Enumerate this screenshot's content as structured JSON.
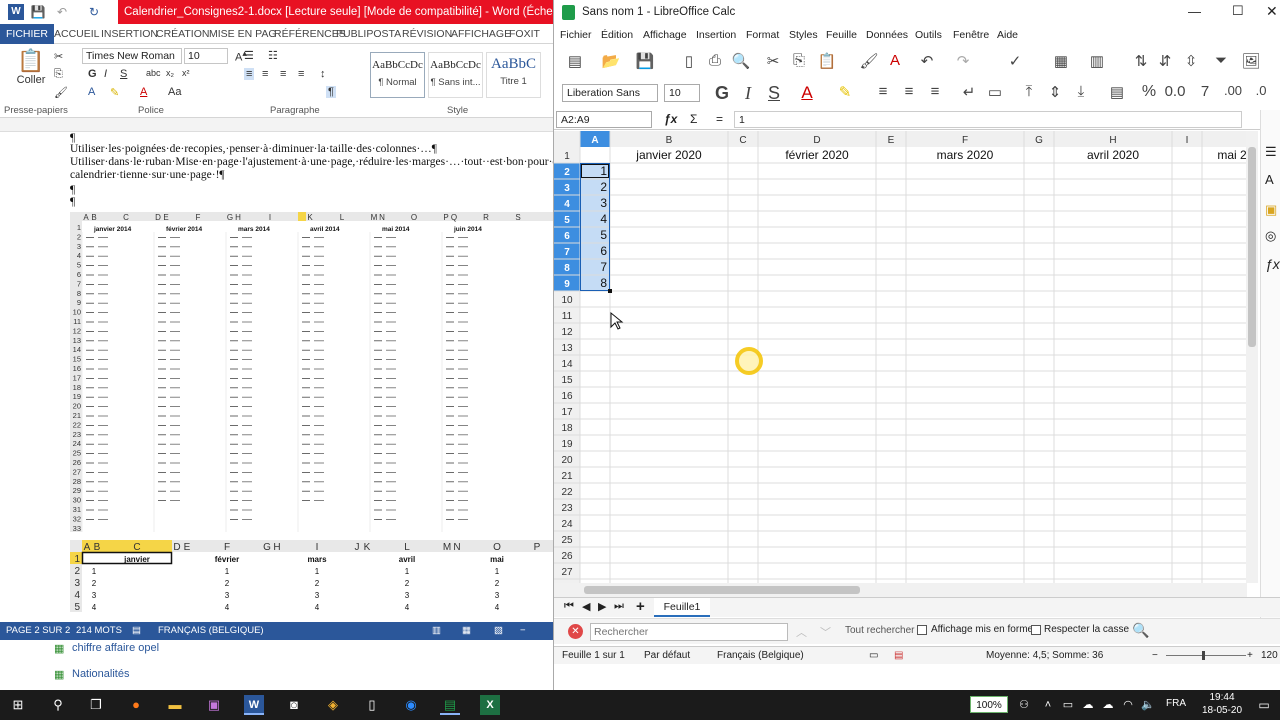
{
  "word": {
    "title": "Calendrier_Consignes2-1.docx [Lecture seule] [Mode de compatibilité] - Word (Échec de l'activat...",
    "tabs": [
      "FICHIER",
      "ACCUEIL",
      "INSERTION",
      "CRÉATION",
      "MISE EN PAG",
      "RÉFÉRENCES",
      "PUBLIPOSTA",
      "RÉVISION",
      "AFFICHAGE",
      "FOXIT REA"
    ],
    "ribbon": {
      "coller": "Coller",
      "font_name": "Times New Roman",
      "font_size": "10",
      "groups": [
        "Presse-papiers",
        "Police",
        "Paragraphe",
        "Style"
      ],
      "styles": [
        {
          "preview": "AaBbCcDc",
          "name": "¶ Normal"
        },
        {
          "preview": "AaBbCcDc",
          "name": "¶ Sans int..."
        },
        {
          "preview": "AaBbC",
          "name": "Titre 1"
        }
      ]
    },
    "doc_lines": [
      "¶",
      "Utiliser·les·poignées·de·recopies,·penser·à·diminuer·la·taille·des·colonnes·…¶",
      "Utiliser·dans·le·ruban·Mise·en·page·l'ajustement·à·une·page,·réduire·les·marges·…·tout··est·bon·pour·que·le",
      "calendrier·tienne·sur·une·page·!¶",
      "¶",
      "¶"
    ],
    "embedded_cols": [
      "A",
      "B",
      "C",
      "D",
      "E",
      "F",
      "G",
      "H",
      "I",
      "J",
      "K",
      "L",
      "M",
      "N",
      "O",
      "P",
      "Q",
      "R",
      "S"
    ],
    "embedded_months": [
      "janvier 2014",
      "février 2014",
      "mars 2014",
      "avril 2014",
      "mai 2014",
      "juin 2014"
    ],
    "embedded2_cols": [
      "A",
      "B",
      "C",
      "D",
      "E",
      "F",
      "G",
      "H",
      "I",
      "J",
      "K",
      "L",
      "M",
      "N",
      "O",
      "P"
    ],
    "embedded2_months": [
      "janvier",
      "février",
      "mars",
      "avril",
      "mai"
    ],
    "status": {
      "page": "PAGE 2 SUR 2",
      "words": "214 MOTS",
      "lang": "FRANÇAIS (BELGIQUE)"
    },
    "below_items": [
      "chiffre affaire opel",
      "Nationalités"
    ]
  },
  "calc": {
    "title": "Sans nom 1 - LibreOffice Calc",
    "menu": [
      "Fichier",
      "Édition",
      "Affichage",
      "Insertion",
      "Format",
      "Styles",
      "Feuille",
      "Données",
      "Outils",
      "Fenêtre",
      "Aide"
    ],
    "font_name": "Liberation Sans",
    "font_size": "10",
    "name_box": "A2:A9",
    "formula": "1",
    "columns": [
      "A",
      "B",
      "C",
      "D",
      "E",
      "F",
      "G",
      "H",
      "I"
    ],
    "row1": [
      "",
      "janvier 2020",
      "",
      "février 2020",
      "",
      "mars 2020",
      "",
      "avril 2020",
      "",
      "mai 2"
    ],
    "colA_values": [
      "1",
      "2",
      "3",
      "4",
      "5",
      "6",
      "7",
      "8"
    ],
    "rows": [
      "1",
      "2",
      "3",
      "4",
      "5",
      "6",
      "7",
      "8",
      "9",
      "10",
      "11",
      "12",
      "13",
      "14",
      "15",
      "16",
      "17",
      "18",
      "19",
      "20",
      "21",
      "22",
      "23",
      "24",
      "25",
      "26",
      "27"
    ],
    "sheet_tab": "Feuille1",
    "find": {
      "placeholder": "Rechercher",
      "find_all": "Tout rechercher",
      "formatted": "Affichage mis en forme",
      "match_case": "Respecter la casse"
    },
    "status": {
      "sheet": "Feuille 1 sur 1",
      "style": "Par défaut",
      "lang": "Français (Belgique)",
      "sum": "Moyenne: 4,5; Somme: 36",
      "zoom": "120"
    }
  },
  "taskbar": {
    "battery": "100%",
    "lang": "FRA",
    "time": "19:44",
    "date": "18-05-20"
  }
}
